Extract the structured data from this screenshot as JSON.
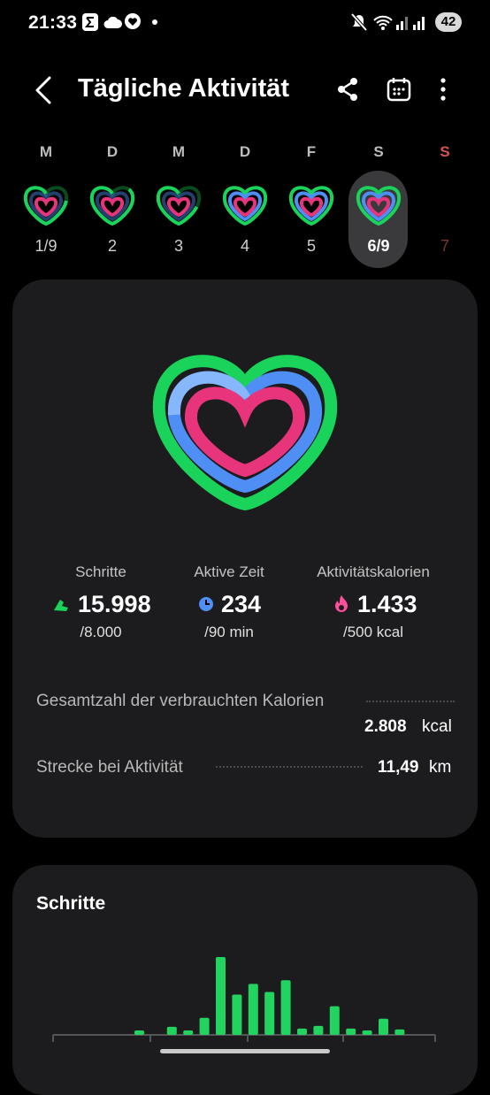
{
  "status_bar": {
    "time": "21:33",
    "battery": "42"
  },
  "header": {
    "title": "Tägliche Aktivität"
  },
  "week": {
    "days": [
      "M",
      "D",
      "M",
      "D",
      "F",
      "S",
      "S"
    ],
    "dates": [
      "1/9",
      "2",
      "3",
      "4",
      "5",
      "6/9",
      "7"
    ],
    "selected_index": 5
  },
  "summary": {
    "steps": {
      "label": "Schritte",
      "value": "15.998",
      "goal": "/8.000"
    },
    "active_time": {
      "label": "Aktive Zeit",
      "value": "234",
      "goal": "/90 min"
    },
    "calories": {
      "label": "Aktivitätskalorien",
      "value": "1.433",
      "goal": "/500 kcal"
    },
    "total_calories": {
      "label": "Gesamtzahl der verbrauchten Kalorien",
      "value": "2.808",
      "unit": "kcal"
    },
    "distance": {
      "label": "Strecke bei Aktivität",
      "value": "11,49",
      "unit": "km"
    }
  },
  "steps_card": {
    "title": "Schritte"
  },
  "chart_data": {
    "type": "bar",
    "title": "Schritte",
    "values": [
      0,
      0,
      0,
      0,
      0,
      0,
      0,
      0,
      0,
      0,
      0,
      0,
      0,
      0,
      0,
      0,
      0,
      0,
      0,
      0,
      0,
      0,
      0,
      0,
      0,
      0,
      0,
      0,
      0,
      0,
      0,
      0,
      0,
      0,
      0,
      0,
      0,
      0,
      0,
      0,
      0,
      0,
      0,
      0,
      0,
      0,
      0,
      0,
      0,
      0,
      0,
      0,
      0,
      0,
      0,
      0,
      0,
      0,
      0,
      0,
      0,
      0,
      0,
      0,
      0,
      0,
      0,
      0,
      0,
      0,
      0,
      0,
      0,
      0
    ],
    "bars": [
      5,
      0,
      9,
      5,
      19,
      87,
      45,
      57,
      48,
      61,
      7,
      10,
      32,
      7,
      5,
      18,
      6
    ],
    "grid": false
  },
  "colors": {
    "ring_steps": "#19d35a",
    "ring_time": "#4f8ef5",
    "ring_calories": "#e8347a",
    "bar": "#22d45f",
    "sunday": "#d9534f"
  }
}
